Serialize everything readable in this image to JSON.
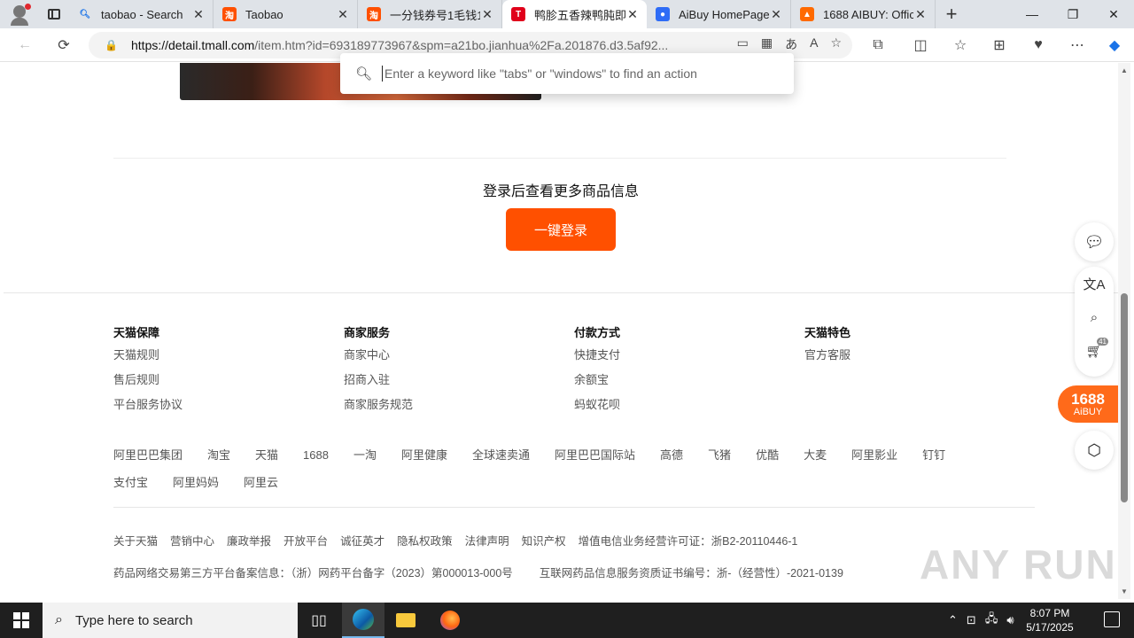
{
  "tabs": [
    {
      "title": "taobao - Search",
      "icon": "search-icon",
      "color": "#1a73e8"
    },
    {
      "title": "Taobao",
      "icon": "taobao-icon",
      "color": "#ff5000"
    },
    {
      "title": "一分钱券号1毛钱1",
      "icon": "taobao-icon",
      "color": "#ff5000"
    },
    {
      "title": "鸭胗五香辣鸭肫即",
      "icon": "tmall-icon",
      "color": "#e0001b",
      "active": true
    },
    {
      "title": "AiBuy HomePage",
      "icon": "aibuy-icon",
      "color": "#2e6cf6"
    },
    {
      "title": "1688 AIBUY: Offici",
      "icon": "1688-icon",
      "color": "#ff6a00"
    }
  ],
  "address": {
    "url_host": "https://detail.tmall.com",
    "url_path": "/item.htm?id=693189773967&spm=a21bo.jianhua%2Fa.201876.d3.5af92..."
  },
  "command_palette": {
    "placeholder": "Enter a keyword like \"tabs\" or \"windows\" to find an action"
  },
  "login": {
    "title": "登录后查看更多商品信息",
    "button": "一键登录"
  },
  "footer_columns": [
    {
      "heading": "天猫保障",
      "links": [
        "天猫规则",
        "售后规则",
        "平台服务协议"
      ]
    },
    {
      "heading": "商家服务",
      "links": [
        "商家中心",
        "招商入驻",
        "商家服务规范"
      ]
    },
    {
      "heading": "付款方式",
      "links": [
        "快捷支付",
        "余额宝",
        "蚂蚁花呗"
      ]
    },
    {
      "heading": "天猫特色",
      "links": [
        "官方客服"
      ]
    }
  ],
  "partner_links_row1": [
    "阿里巴巴集团",
    "淘宝",
    "天猫",
    "1688",
    "一淘",
    "阿里健康",
    "全球速卖通",
    "阿里巴巴国际站",
    "高德",
    "飞猪",
    "优酷",
    "大麦",
    "阿里影业",
    "钉钉"
  ],
  "partner_links_row2": [
    "支付宝",
    "阿里妈妈",
    "阿里云"
  ],
  "legal_links": [
    "关于天猫",
    "营销中心",
    "廉政举报",
    "开放平台",
    "诚征英才",
    "隐私权政策",
    "法律声明",
    "知识产权",
    "增值电信业务经营许可证：浙B2-20110446-1"
  ],
  "license_row": [
    "药品网络交易第三方平台备案信息：（浙）网药平台备字（2023）第000013-000号",
    "互联网药品信息服务资质证书编号：浙-（经营性）-2021-0139"
  ],
  "side_toolbar": {
    "aibuy_top": "1688",
    "aibuy_bottom": "AiBUY",
    "badge": "41"
  },
  "watermark": "ANY RUN",
  "taskbar": {
    "search_placeholder": "Type here to search",
    "time": "8:07 PM",
    "date": "5/17/2025"
  },
  "colors": {
    "accent": "#ff5000",
    "aibuy": "#ff6a1a"
  }
}
